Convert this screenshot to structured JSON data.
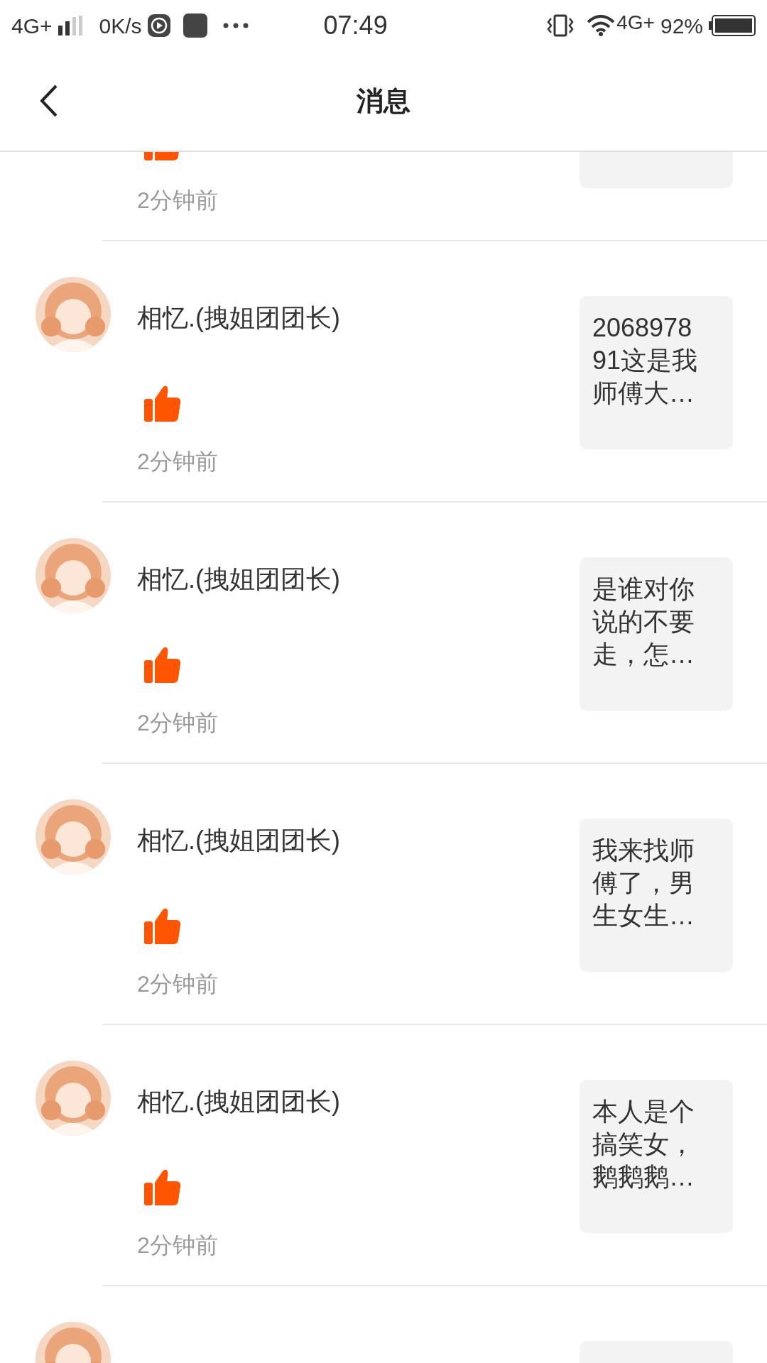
{
  "status_bar": {
    "network": "4G+",
    "speed": "0K/s",
    "time": "07:49",
    "network_right": "4G+",
    "battery": "92%"
  },
  "header": {
    "title": "消息"
  },
  "messages": [
    {
      "kind": "clipped_top",
      "time": "2分钟前"
    },
    {
      "kind": "full",
      "name": "相忆.(拽姐团团长)",
      "time": "2分钟前",
      "preview": [
        "2068978",
        "91这是我",
        "师傅大…"
      ]
    },
    {
      "kind": "full",
      "name": "相忆.(拽姐团团长)",
      "time": "2分钟前",
      "preview": [
        "是谁对你",
        "说的不要",
        "走，怎…"
      ]
    },
    {
      "kind": "full",
      "name": "相忆.(拽姐团团长)",
      "time": "2分钟前",
      "preview": [
        "我来找师",
        "傅了，男",
        "生女生…"
      ]
    },
    {
      "kind": "full",
      "name": "相忆.(拽姐团团长)",
      "time": "2分钟前",
      "preview": [
        "本人是个",
        "搞笑女，",
        "鹅鹅鹅…"
      ]
    },
    {
      "kind": "clipped_bottom"
    }
  ]
}
